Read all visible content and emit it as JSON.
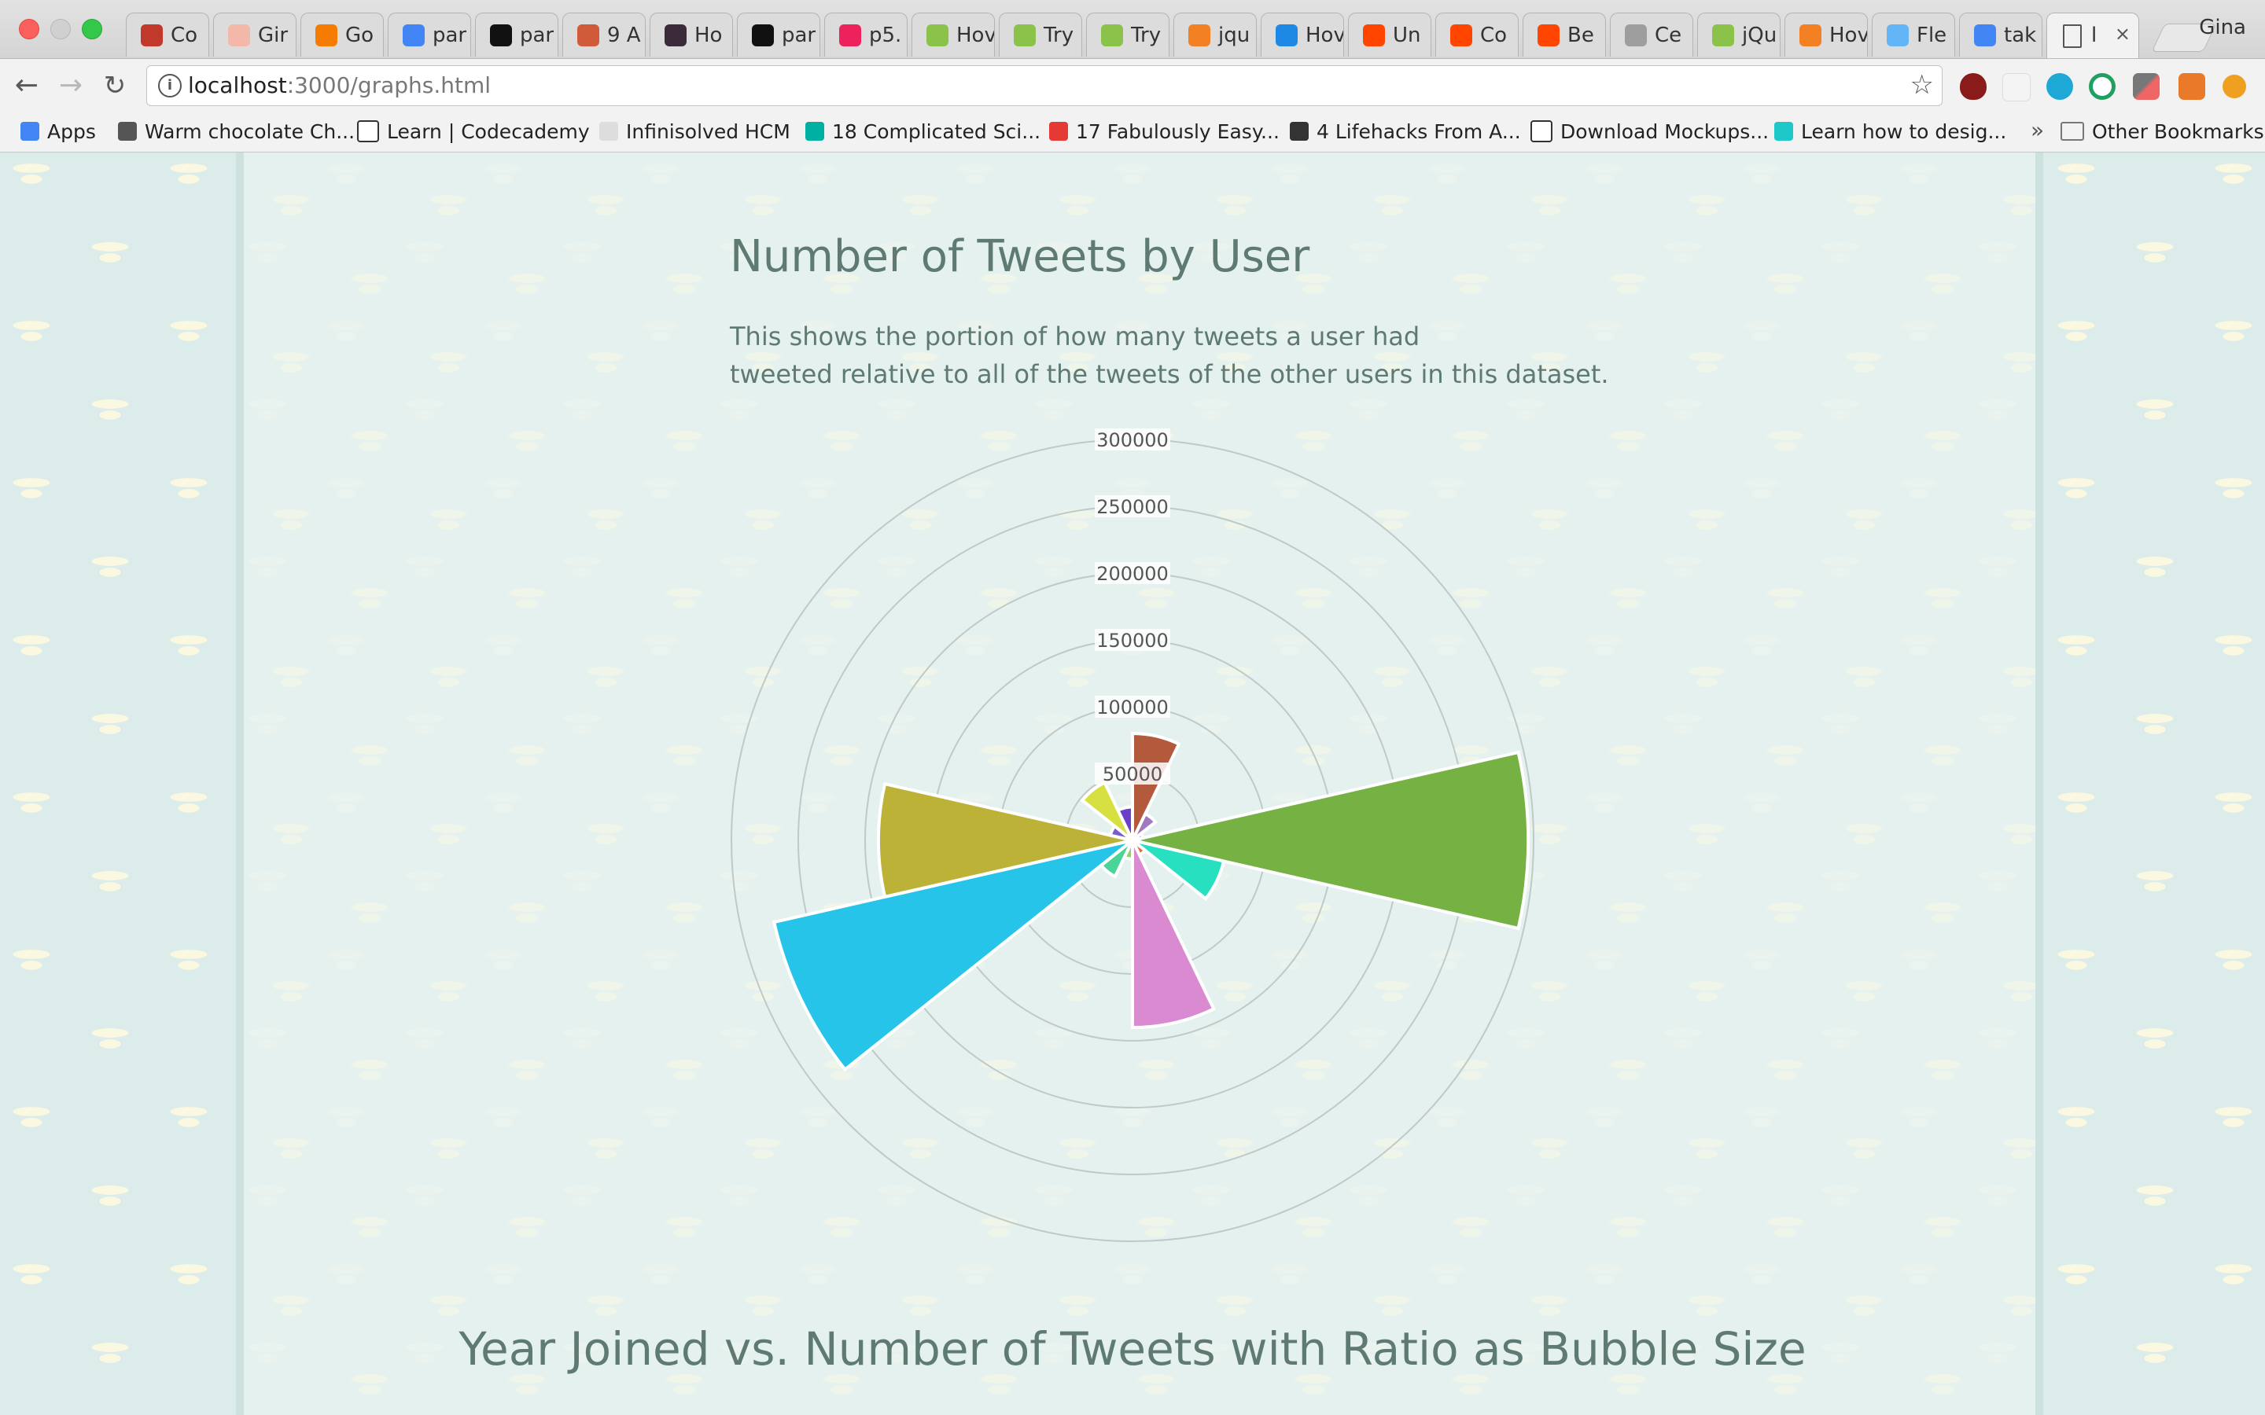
{
  "browser": {
    "tabs": [
      {
        "label": "Co",
        "color": "#c0392b"
      },
      {
        "label": "Gir",
        "color": "#f3b8a9"
      },
      {
        "label": "Go",
        "color": "#f57c00"
      },
      {
        "label": "par",
        "color": "#4285f4"
      },
      {
        "label": "par",
        "color": "#111111"
      },
      {
        "label": "9 A",
        "color": "#d05a3a"
      },
      {
        "label": "Ho",
        "color": "#3a2a3a"
      },
      {
        "label": "par",
        "color": "#111111"
      },
      {
        "label": "p5.",
        "color": "#ed225d"
      },
      {
        "label": "Hov",
        "color": "#8bc34a"
      },
      {
        "label": "Try",
        "color": "#8bc34a"
      },
      {
        "label": "Try",
        "color": "#8bc34a"
      },
      {
        "label": "jqu",
        "color": "#f48024"
      },
      {
        "label": "Hov",
        "color": "#1e88e5"
      },
      {
        "label": "Un",
        "color": "#ff4500"
      },
      {
        "label": "Co",
        "color": "#ff4500"
      },
      {
        "label": "Be",
        "color": "#ff4500"
      },
      {
        "label": "Ce",
        "color": "#9e9e9e"
      },
      {
        "label": "jQu",
        "color": "#8bc34a"
      },
      {
        "label": "Hov",
        "color": "#f48024"
      },
      {
        "label": "Fle",
        "color": "#64b5f6"
      },
      {
        "label": "tak",
        "color": "#4285f4"
      }
    ],
    "active_tab": {
      "label": "l",
      "close": "×"
    },
    "profile_name": "Gina",
    "url_host": "localhost",
    "url_path": ":3000/graphs.html",
    "bookmarks": [
      {
        "label": "Apps",
        "color": "#4285f4"
      },
      {
        "label": "Warm chocolate Ch...",
        "color": "#555555"
      },
      {
        "label": "Learn | Codecademy",
        "color": "#ffffff"
      },
      {
        "label": "Infinisolved HCM",
        "color": "#dddddd"
      },
      {
        "label": "18 Complicated Sci...",
        "color": "#00b0a0"
      },
      {
        "label": "17 Fabulously Easy...",
        "color": "#e53935"
      },
      {
        "label": "4 Lifehacks From A...",
        "color": "#333333"
      },
      {
        "label": "Download Mockups...",
        "color": "#ffffff"
      },
      {
        "label": "Learn how to desig...",
        "color": "#1ec8c8"
      }
    ],
    "bookmarks_more": "»",
    "other_bookmarks": "Other Bookmarks"
  },
  "page": {
    "title": "Number of Tweets by User",
    "description_line1": "This shows the portion of how many tweets a user had",
    "description_line2": "tweeted relative to all of the tweets of the other users in this dataset.",
    "next_title": "Year Joined vs. Number of Tweets with Ratio as Bubble Size"
  },
  "chart_data": {
    "type": "polarArea",
    "title": "Number of Tweets by User",
    "r_ticks": [
      50000,
      100000,
      150000,
      200000,
      250000,
      300000
    ],
    "r_max": 300000,
    "segments": [
      {
        "value": 296000,
        "color": "#75b143"
      },
      {
        "value": 70000,
        "color": "#26e0bf"
      },
      {
        "value": 12000,
        "color": "#e06a4a"
      },
      {
        "value": 140000,
        "color": "#da8ad0"
      },
      {
        "value": 14000,
        "color": "#8ed45a"
      },
      {
        "value": 30000,
        "color": "#4bd49a"
      },
      {
        "value": 275000,
        "color": "#25c4e8"
      },
      {
        "value": 190000,
        "color": "#bdb238"
      },
      {
        "value": 17000,
        "color": "#7c5ccc"
      },
      {
        "value": 48000,
        "color": "#d6e040"
      },
      {
        "value": 25000,
        "color": "#6b3fc8"
      },
      {
        "value": 80000,
        "color": "#b35a3c"
      },
      {
        "value": 22000,
        "color": "#a07ac0"
      },
      {
        "value": 8000,
        "color": "#5aa8d6"
      }
    ]
  }
}
